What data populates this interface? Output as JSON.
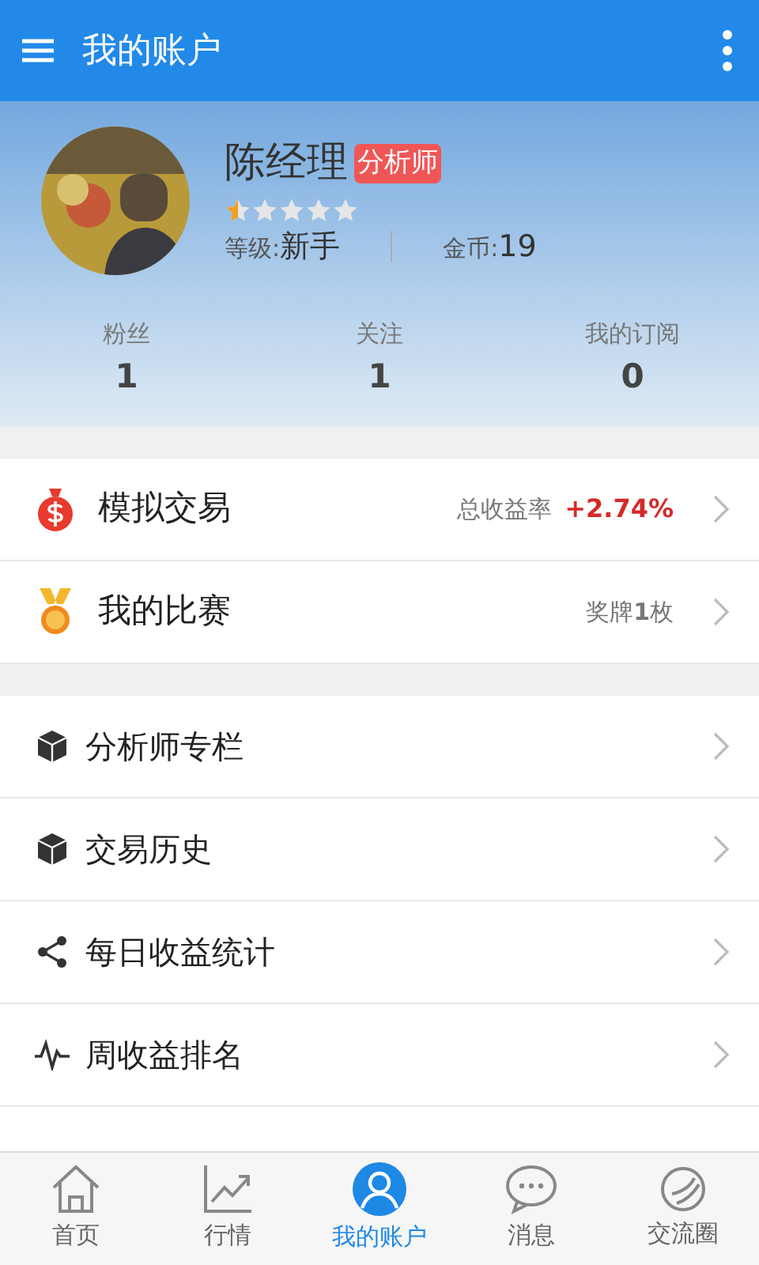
{
  "app_bar": {
    "title": "我的账户"
  },
  "profile": {
    "name": "陈经理",
    "badge": "分析师",
    "stars": 0.5,
    "level_label": "等级:",
    "level_value": "新手",
    "coins_label": "金币:",
    "coins_value": "19",
    "stats": [
      {
        "label": "粉丝",
        "value": "1"
      },
      {
        "label": "关注",
        "value": "1"
      },
      {
        "label": "我的订阅",
        "value": "0"
      }
    ]
  },
  "feature_rows": [
    {
      "kind": "money",
      "label": "模拟交易",
      "note": "总收益率",
      "value": "+2.74%"
    },
    {
      "kind": "medal",
      "label": "我的比赛",
      "note": "奖牌**1**枚"
    }
  ],
  "menu_rows": [
    {
      "kind": "cube",
      "label": "分析师专栏"
    },
    {
      "kind": "cube",
      "label": "交易历史"
    },
    {
      "kind": "share",
      "label": "每日收益统计"
    },
    {
      "kind": "pulse",
      "label": "周收益排名"
    }
  ],
  "tab_bar": [
    {
      "kind": "home",
      "label": "首页",
      "selected": false
    },
    {
      "kind": "chart",
      "label": "行情",
      "selected": false
    },
    {
      "kind": "user",
      "label": "我的账户",
      "selected": true
    },
    {
      "kind": "chat",
      "label": "消息",
      "selected": false
    },
    {
      "kind": "globe",
      "label": "交流圈",
      "selected": false
    }
  ]
}
